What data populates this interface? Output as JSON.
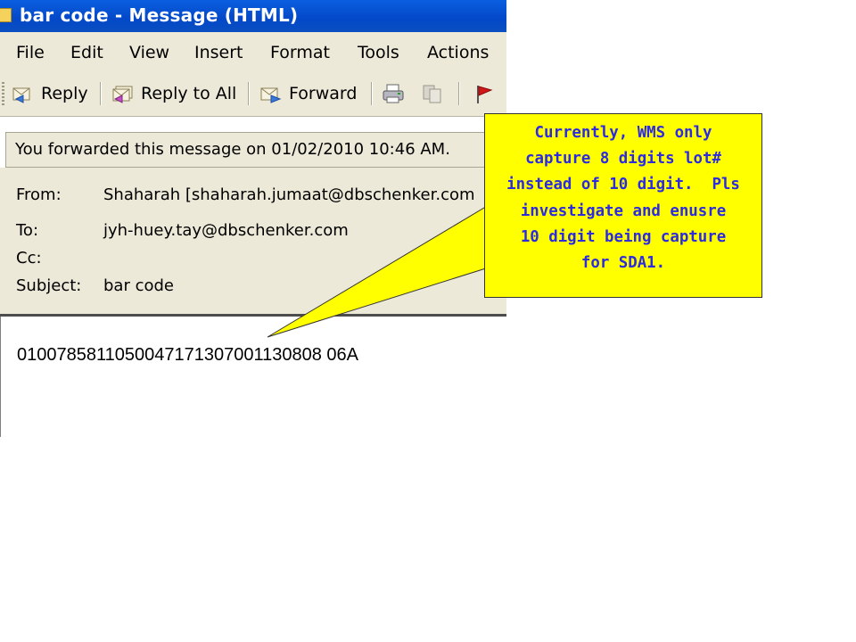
{
  "window": {
    "title": "bar code - Message (HTML)"
  },
  "menu": {
    "items": [
      "File",
      "Edit",
      "View",
      "Insert",
      "Format",
      "Tools",
      "Actions"
    ]
  },
  "toolbar": {
    "reply_label": "Reply",
    "reply_all_label": "Reply to All",
    "forward_label": "Forward",
    "icons": [
      "print-icon",
      "copy-icon",
      "flag-icon"
    ]
  },
  "info_bar": {
    "text": "You forwarded this message on 01/02/2010 10:46 AM."
  },
  "headers": {
    "from_label": "From:",
    "from_value": "Shaharah [shaharah.jumaat@dbschenker.com",
    "to_label": "To:",
    "to_value": "jyh-huey.tay@dbschenker.com",
    "cc_label": "Cc:",
    "cc_value": "",
    "subject_label": "Subject:",
    "subject_value": "bar code"
  },
  "message": {
    "body": "0100785811050047171307001130808 06A"
  },
  "callout": {
    "lines": [
      "Currently, WMS only",
      "capture 8 digits lot#",
      "instead of 10 digit.  Pls",
      "investigate and enusre",
      "10 digit being capture",
      "for SDA1."
    ],
    "background": "#ffff00",
    "text_color": "#2d2be0"
  }
}
